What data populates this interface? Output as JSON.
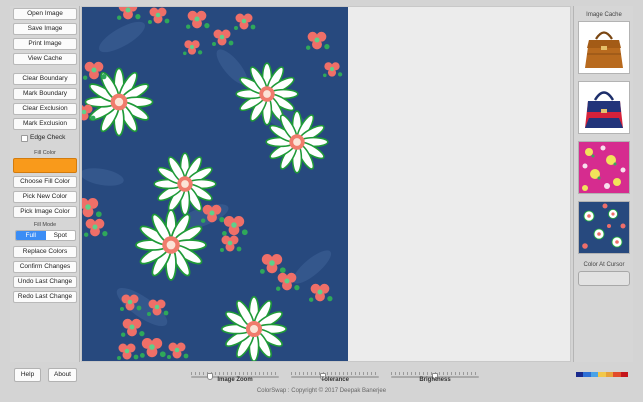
{
  "sidebar": {
    "buttons": {
      "open_image": "Open Image",
      "save_image": "Save Image",
      "print_image": "Print Image",
      "view_cache": "View Cache",
      "clear_boundary": "Clear Boundary",
      "mark_boundary": "Mark Boundary",
      "clear_exclusion": "Clear Exclusion",
      "mark_exclusion": "Mark Exclusion",
      "choose_fill_color": "Choose Fill Color",
      "pick_new_color": "Pick New Color",
      "pick_image_color": "Pick Image Color",
      "replace_colors": "Replace Colors",
      "confirm_changes": "Confirm Changes",
      "undo_last_change": "Undo Last Change",
      "redo_last_change": "Redo Last Change"
    },
    "edge_check_label": "Edge Check",
    "edge_check_checked": false,
    "fill_color_label": "Fill Color",
    "fill_color_value": "#f99a1b",
    "fill_mode_label": "Fill Mode",
    "fill_mode_options": [
      "Full",
      "Spot"
    ],
    "fill_mode_selected": "Full"
  },
  "right_panel": {
    "title": "Image Cache",
    "thumbnails": [
      "brown-handbag-thumbnail",
      "red-blue-handbag-thumbnail",
      "pink-floral-fabric-thumbnail",
      "blue-floral-fabric-thumbnail"
    ],
    "color_at_cursor_label": "Color At Cursor"
  },
  "bottom": {
    "help_label": "Help",
    "about_label": "About",
    "sliders": [
      {
        "label": "Image Zoom",
        "value": 0.2
      },
      {
        "label": "Tolerance",
        "value": 0.35
      },
      {
        "label": "Brightness",
        "value": 0.5
      }
    ],
    "copyright": "ColorSwap : Copyright © 2017  Deepak Banerjee",
    "palette": [
      "#1a2a8c",
      "#2d6fd6",
      "#4aa3e8",
      "#f2c84b",
      "#e8a13a",
      "#e24b2b",
      "#c4161c"
    ]
  },
  "colors": {
    "accent": "#3b8df5",
    "fabric_background": "#27497e",
    "flower_pink": "#ee6e6a",
    "flower_green": "#22b03f"
  }
}
